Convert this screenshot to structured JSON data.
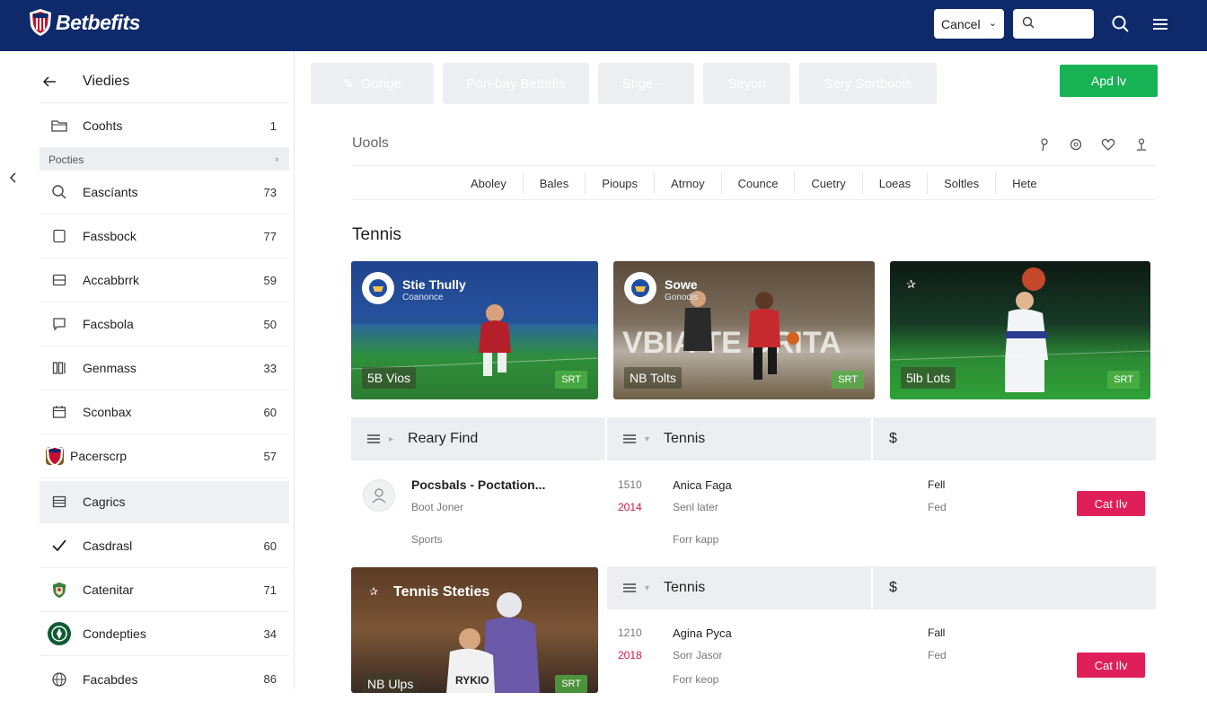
{
  "header": {
    "brand": "Betbefits",
    "select_value": "Cancel",
    "search_placeholder": "",
    "colors": {
      "bar": "#0f2a6b",
      "accent_green": "#17b355",
      "accent_pink": "#df1f5a"
    }
  },
  "sidebar": {
    "title": "Viedies",
    "top_item": {
      "label": "Coohts",
      "count": "1",
      "icon": "folder-icon"
    },
    "section": {
      "label": "Pocties"
    },
    "items": [
      {
        "label": "Eascíants",
        "count": "73",
        "icon": "search-icon"
      },
      {
        "label": "Fassbock",
        "count": "77",
        "icon": "square-icon"
      },
      {
        "label": "Accabbrrk",
        "count": "59",
        "icon": "card-icon"
      },
      {
        "label": "Facsbola",
        "count": "50",
        "icon": "chat-icon"
      },
      {
        "label": "Genmass",
        "count": "33",
        "icon": "columns-icon"
      },
      {
        "label": "Sconbax",
        "count": "60",
        "icon": "calendar-icon"
      },
      {
        "label": "Pacerscrp",
        "count": "57",
        "icon": "shield-logo-icon"
      },
      {
        "label": "Cagrics",
        "count": "",
        "icon": "list-icon"
      },
      {
        "label": "Casdrasl",
        "count": "60",
        "icon": "check-icon"
      },
      {
        "label": "Catenitar",
        "count": "71",
        "icon": "crest-icon"
      },
      {
        "label": "Condepties",
        "count": "34",
        "icon": "team-badge-icon"
      },
      {
        "label": "Facabdes",
        "count": "86",
        "icon": "globe-icon"
      }
    ]
  },
  "filters": {
    "chips": [
      "Gorige",
      "Pon-bay Bettefis",
      "Stige ···",
      "Seyon",
      "Sery Sortbools"
    ],
    "apply_label": "Apd lv"
  },
  "tools": {
    "label": "Uools",
    "tabs": [
      "Aboley",
      "Bales",
      "Pioups",
      "Atrnoy",
      "Counce",
      "Cuetry",
      "Loeas",
      "Soltles",
      "Hete"
    ]
  },
  "main": {
    "section_title": "Tennis",
    "cards": [
      {
        "title": "Stie Thully",
        "subtitle": "Coanonce",
        "stat": "5B Vios",
        "tag": "SRT"
      },
      {
        "title": "Sowe",
        "subtitle": "Gonodis",
        "stat": "NB Tolts",
        "tag": "SRT",
        "banner": "VBIA TE DRITA"
      },
      {
        "title": "",
        "subtitle": "",
        "stat": "5lb Lots",
        "tag": "SRT"
      }
    ],
    "table1": {
      "headers": [
        "Reary Find",
        "Tennis",
        "$"
      ],
      "row": {
        "name": "Pocsbals - Poctation...",
        "person": "Boot Joner",
        "category": "Sports",
        "num": "1510",
        "year": "2014",
        "player": "Anica Faga",
        "player_sub": "Senl later",
        "player_extra": "Forr kapp",
        "status": "Fell",
        "status_sub": "Fed",
        "cta": "Cat Ilv"
      }
    },
    "promo_card": {
      "title": "Tennis Steties",
      "stat": "NB Ulps",
      "tag": "SRT"
    },
    "table2": {
      "headers": [
        "Tennis",
        "$"
      ],
      "row": {
        "num": "1210",
        "year": "2018",
        "player": "Agina Pyca",
        "player_sub": "Sorr Jasor",
        "player_extra": "Forr keop",
        "status": "Fall",
        "status_sub": "Fed",
        "cta": "Cat Ilv"
      }
    }
  }
}
